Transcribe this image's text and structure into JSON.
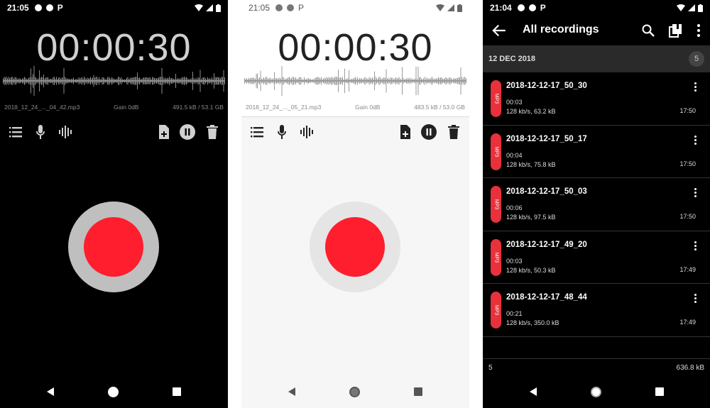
{
  "screens": [
    {
      "status_time": "21:05",
      "status_letter": "P",
      "timer": "00:00:30",
      "file_name": "2018_12_24_..._04_42.mp3",
      "gain": "Gain 0dB",
      "storage": "491.5 kB / 53.1 GB"
    },
    {
      "status_time": "21:05",
      "status_letter": "P",
      "timer": "00:00:30",
      "file_name": "2018_12_24_..._05_21.mp3",
      "gain": "Gain 0dB",
      "storage": "483.5 kB / 53.0 GB"
    }
  ],
  "toolbar_icons": [
    "list-icon",
    "mic-icon",
    "waveform-icon",
    "add-file-icon",
    "pause-icon",
    "delete-icon"
  ],
  "recordings": {
    "status_time": "21:04",
    "status_letter": "P",
    "title": "All recordings",
    "section_date": "12 DEC 2018",
    "section_count": "5",
    "format_badge": "MP3",
    "items": [
      {
        "name": "2018-12-12-17_50_30",
        "duration": "00:03",
        "info": "128 kb/s, 63.2 kB",
        "time": "17:50"
      },
      {
        "name": "2018-12-12-17_50_17",
        "duration": "00:04",
        "info": "128 kb/s, 75.8 kB",
        "time": "17:50"
      },
      {
        "name": "2018-12-12-17_50_03",
        "duration": "00:06",
        "info": "128 kb/s, 97.5 kB",
        "time": "17:50"
      },
      {
        "name": "2018-12-12-17_49_20",
        "duration": "00:03",
        "info": "128 kb/s, 50.3 kB",
        "time": "17:49"
      },
      {
        "name": "2018-12-12-17_48_44",
        "duration": "00:21",
        "info": "128 kb/s, 350.0 kB",
        "time": "17:49"
      }
    ],
    "footer_count": "5",
    "footer_size": "636.8 kB"
  },
  "colors": {
    "record_red": "#ff1e2d",
    "mp3_badge": "#e8313b"
  }
}
